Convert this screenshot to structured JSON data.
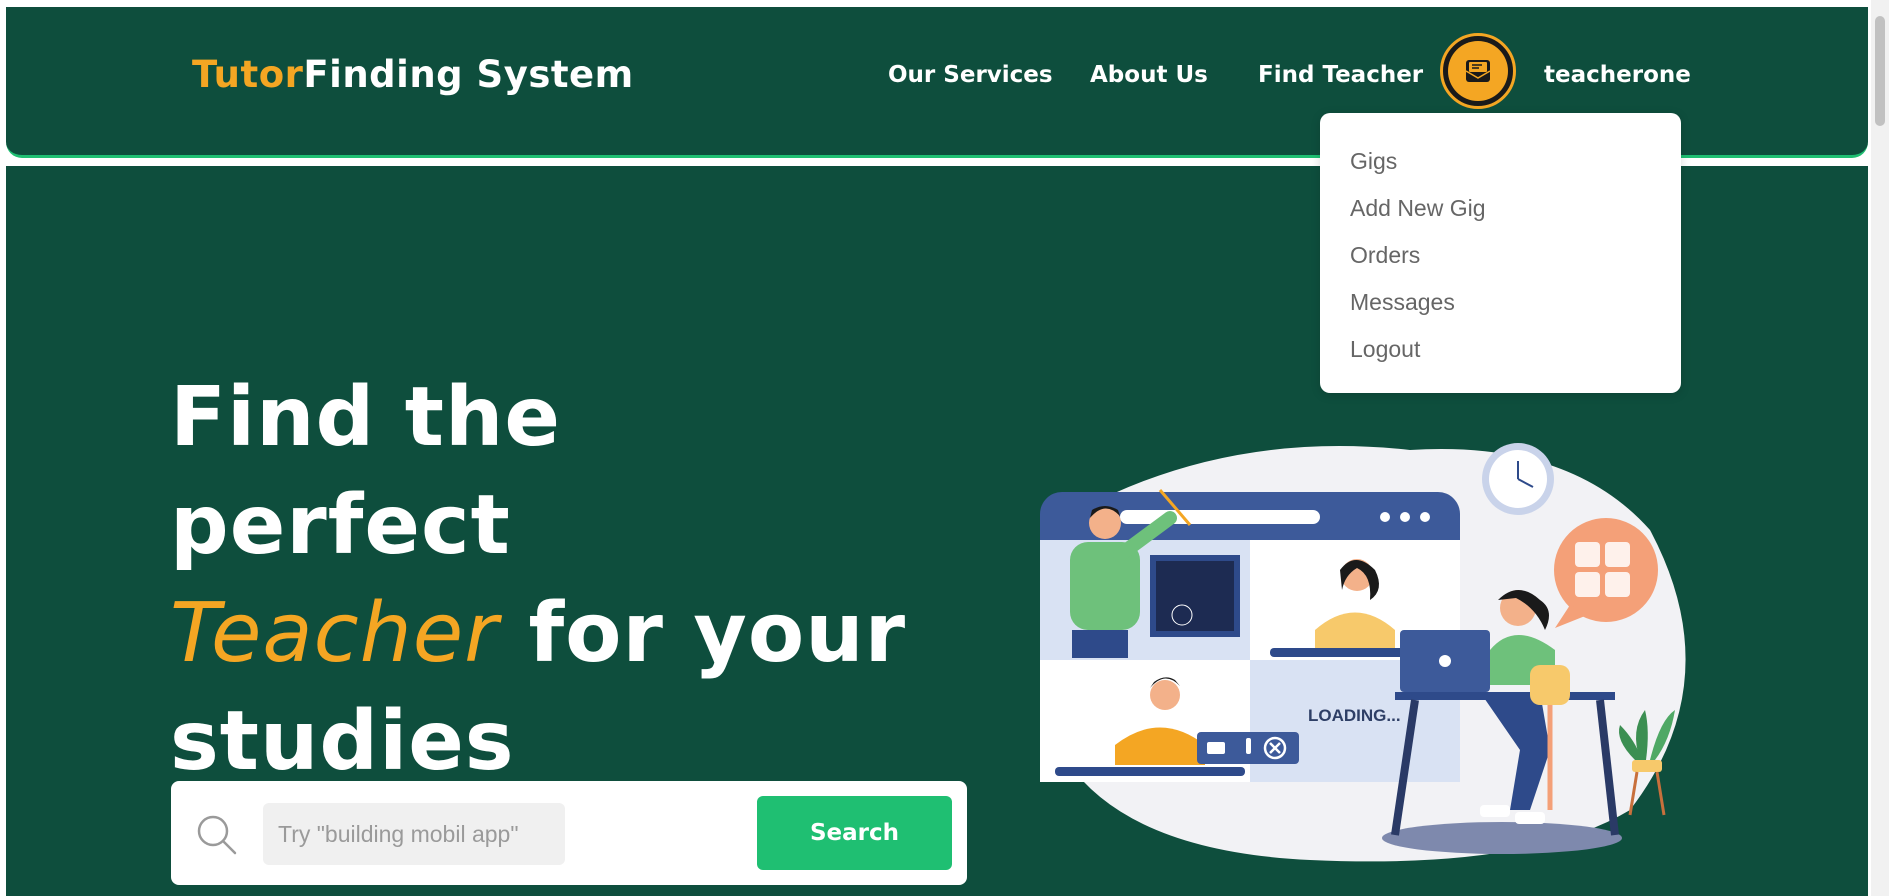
{
  "brand": {
    "accent": "Tutor",
    "rest": "Finding System"
  },
  "nav": {
    "services": "Our Services",
    "about": "About Us",
    "find_teacher": "Find Teacher",
    "username": "teacherone"
  },
  "dropdown": {
    "items": [
      "Gigs",
      "Add New Gig",
      "Orders",
      "Messages",
      "Logout"
    ]
  },
  "hero": {
    "line1": "Find the perfect",
    "teacher_word": "Teacher",
    "line2_rest": "for your",
    "line3": "studies"
  },
  "search": {
    "placeholder": "Try \"building mobil app\"",
    "button_label": "Search"
  },
  "illustration": {
    "loading_text": "LOADING..."
  },
  "colors": {
    "primary": "#0e4e3d",
    "accent": "#f4a623",
    "button": "#1fbf72"
  }
}
